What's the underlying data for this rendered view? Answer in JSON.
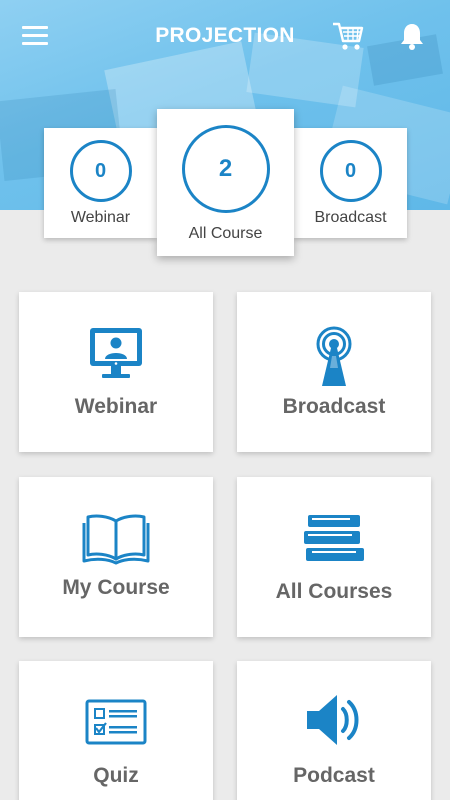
{
  "header": {
    "title": "PROJECTION"
  },
  "icons": {
    "menu": "menu-icon",
    "cart": "cart-icon",
    "notifications": "bell-icon"
  },
  "accent_color": "#1b84c6",
  "stats": [
    {
      "count": "0",
      "label": "Webinar"
    },
    {
      "count": "2",
      "label": "All Course"
    },
    {
      "count": "0",
      "label": "Broadcast"
    }
  ],
  "tiles": [
    {
      "label": "Webinar",
      "icon": "monitor-user-icon"
    },
    {
      "label": "Broadcast",
      "icon": "broadcast-antenna-icon"
    },
    {
      "label": "My Course",
      "icon": "open-book-icon"
    },
    {
      "label": "All Courses",
      "icon": "book-stack-icon"
    },
    {
      "label": "Quiz",
      "icon": "quiz-card-icon"
    },
    {
      "label": "Podcast",
      "icon": "speaker-icon"
    }
  ]
}
